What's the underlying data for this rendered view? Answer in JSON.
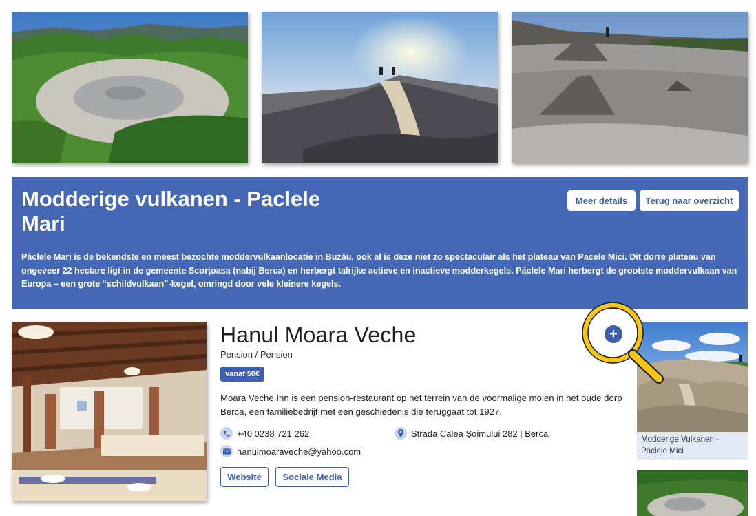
{
  "gallery": {
    "images": [
      "mud-volcano-aerial-photo",
      "mud-volcano-sunset-photo",
      "mud-volcano-cones-photo"
    ]
  },
  "banner": {
    "title": "Modderige vulkanen - Paclele Mari",
    "description": "Pâclele Mari is de bekendste en meest bezochte moddervulkaanlocatie in Buzău, ook al is deze niet zo spectaculair als het plateau van Pacele Mici. Dit dorre plateau van ongeveer 22 hectare ligt in de gemeente Scorțoasa (nabij Berca) en herbergt talrijke actieve en inactieve modderkegels. Pâclele Mari herbergt de grootste moddervulkaan van Europa – een grote “schildvulkaan”-kegel, omringd door vele kleinere kegels.",
    "more_details_label": "Meer details",
    "back_label": "Terug naar overzicht",
    "background_color": "#4468b5"
  },
  "listing": {
    "title": "Hanul Moara Veche",
    "type": "Pension / Pension",
    "price_badge": "vanaf 50€",
    "description": "Moara Veche Inn is een pension-restaurant op het terrein van de voormalige molen in het oude dorp Berca, een familiebedrijf met een geschiedenis die teruggaat tot 1927.",
    "phone": "+40 0238 721 262",
    "address": "Strada Calea Șoimului 282 | Berca",
    "email": "hanulmoaraveche@yahoo.com",
    "website_label": "Website",
    "social_label": "Sociale Media",
    "add_icon": "plus-icon",
    "accent_color": "#3d5fb0"
  },
  "sidebar": {
    "related": [
      {
        "label": "Modderige Vulkanen - Paclele Mici",
        "image": "paclele-mici-photo"
      },
      {
        "label": "",
        "image": "paclele-aerial-photo"
      }
    ]
  },
  "overlay": {
    "icon": "magnifier-icon",
    "color": "#f5c518"
  }
}
